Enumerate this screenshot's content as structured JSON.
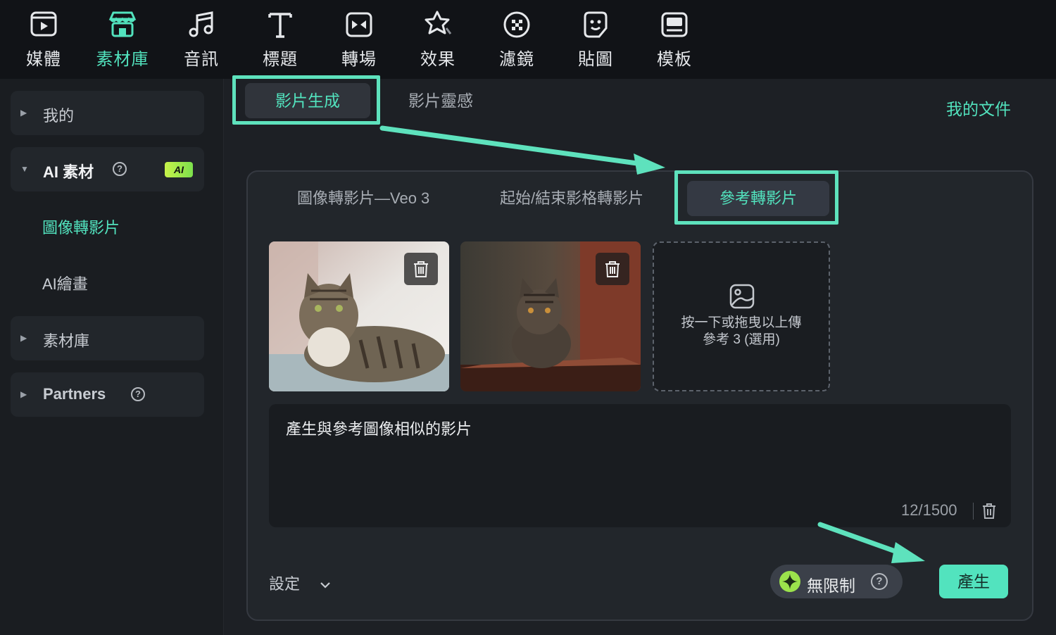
{
  "toolbar": {
    "items": [
      {
        "label": "媒體",
        "icon": "media-icon"
      },
      {
        "label": "素材庫",
        "icon": "store-icon"
      },
      {
        "label": "音訊",
        "icon": "music-icon"
      },
      {
        "label": "標題",
        "icon": "title-icon"
      },
      {
        "label": "轉場",
        "icon": "transition-icon"
      },
      {
        "label": "效果",
        "icon": "effects-icon"
      },
      {
        "label": "濾鏡",
        "icon": "filter-icon"
      },
      {
        "label": "貼圖",
        "icon": "sticker-icon"
      },
      {
        "label": "模板",
        "icon": "template-icon"
      }
    ],
    "active_index": 1
  },
  "sidebar": {
    "mine": "我的",
    "ai_assets": "AI 素材",
    "ai_badge": "AI",
    "image_to_video": "圖像轉影片",
    "ai_painting": "AI繪畫",
    "library": "素材庫",
    "partners": "Partners"
  },
  "main": {
    "tab_generate": "影片生成",
    "tab_inspiration": "影片靈感",
    "my_documents": "我的文件",
    "subtabs": {
      "veo": "圖像轉影片—Veo 3",
      "start_end": "起始/結束影格轉影片",
      "reference": "參考轉影片"
    },
    "upload_text_1": "按一下或拖曳以上傳",
    "upload_text_2": "參考 3 (選用)",
    "prompt": "產生與參考圖像相似的影片",
    "char_count": "12/1500",
    "settings": "設定",
    "unlimited": "無限制",
    "generate": "產生"
  },
  "colors": {
    "accent": "#52e3be",
    "highlight": "#5ee2bd",
    "background": "#1d2025",
    "toolbar": "#111317"
  }
}
